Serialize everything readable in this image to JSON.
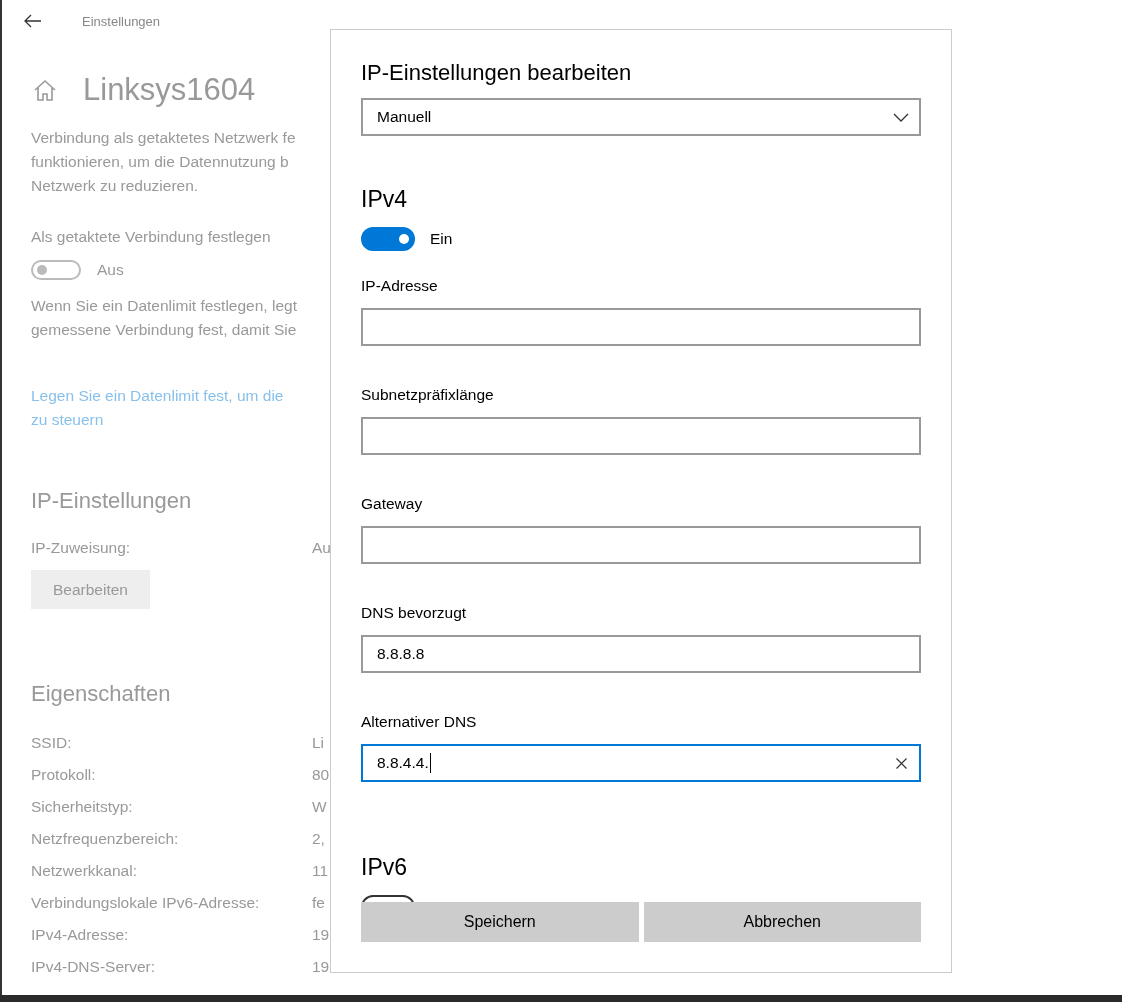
{
  "header": {
    "title": "Einstellungen"
  },
  "page": {
    "title": "Linksys1604",
    "description_lines": [
      "Verbindung als getaktetes Netzwerk fe",
      "funktionieren, um die Datennutzung b",
      "Netzwerk zu reduzieren."
    ],
    "metered": {
      "label": "Als getaktete Verbindung festlegen",
      "on": false,
      "state_text": "Aus"
    },
    "data_limit_lines": [
      "Wenn Sie ein Datenlimit festlegen, legt",
      "gemessene Verbindung fest, damit Sie"
    ],
    "link_lines": [
      "Legen Sie ein Datenlimit fest, um die",
      "zu steuern"
    ],
    "ip_section": {
      "heading": "IP-Einstellungen",
      "assignment_label": "IP-Zuweisung:",
      "assignment_value": "Au",
      "edit_button": "Bearbeiten"
    },
    "properties": {
      "heading": "Eigenschaften",
      "rows": [
        {
          "label": "SSID:",
          "value": "Li"
        },
        {
          "label": "Protokoll:",
          "value": "80"
        },
        {
          "label": "Sicherheitstyp:",
          "value": "W"
        },
        {
          "label": "Netzfrequenzbereich:",
          "value": "2,"
        },
        {
          "label": "Netzwerkkanal:",
          "value": "11"
        },
        {
          "label": "Verbindungslokale IPv6-Adresse:",
          "value": "fe"
        },
        {
          "label": "IPv4-Adresse:",
          "value": "19"
        },
        {
          "label": "IPv4-DNS-Server:",
          "value": "19"
        }
      ]
    }
  },
  "dialog": {
    "title": "IP-Einstellungen bearbeiten",
    "mode": "Manuell",
    "ipv4": {
      "heading": "IPv4",
      "on": true,
      "state_text": "Ein"
    },
    "fields": [
      {
        "label": "IP-Adresse",
        "focused": false
      },
      {
        "label": "Subnetzpräfixlänge",
        "focused": false
      },
      {
        "label": "Gateway",
        "focused": false
      },
      {
        "label": "DNS bevorzugt",
        "value": "8.8.8.8",
        "focused": false
      },
      {
        "label": "Alternativer DNS",
        "value": "8.8.4.4.",
        "focused": true
      }
    ],
    "ipv6": {
      "heading": "IPv6",
      "on": false
    },
    "buttons": [
      "Speichern",
      "Abbrechen"
    ]
  }
}
